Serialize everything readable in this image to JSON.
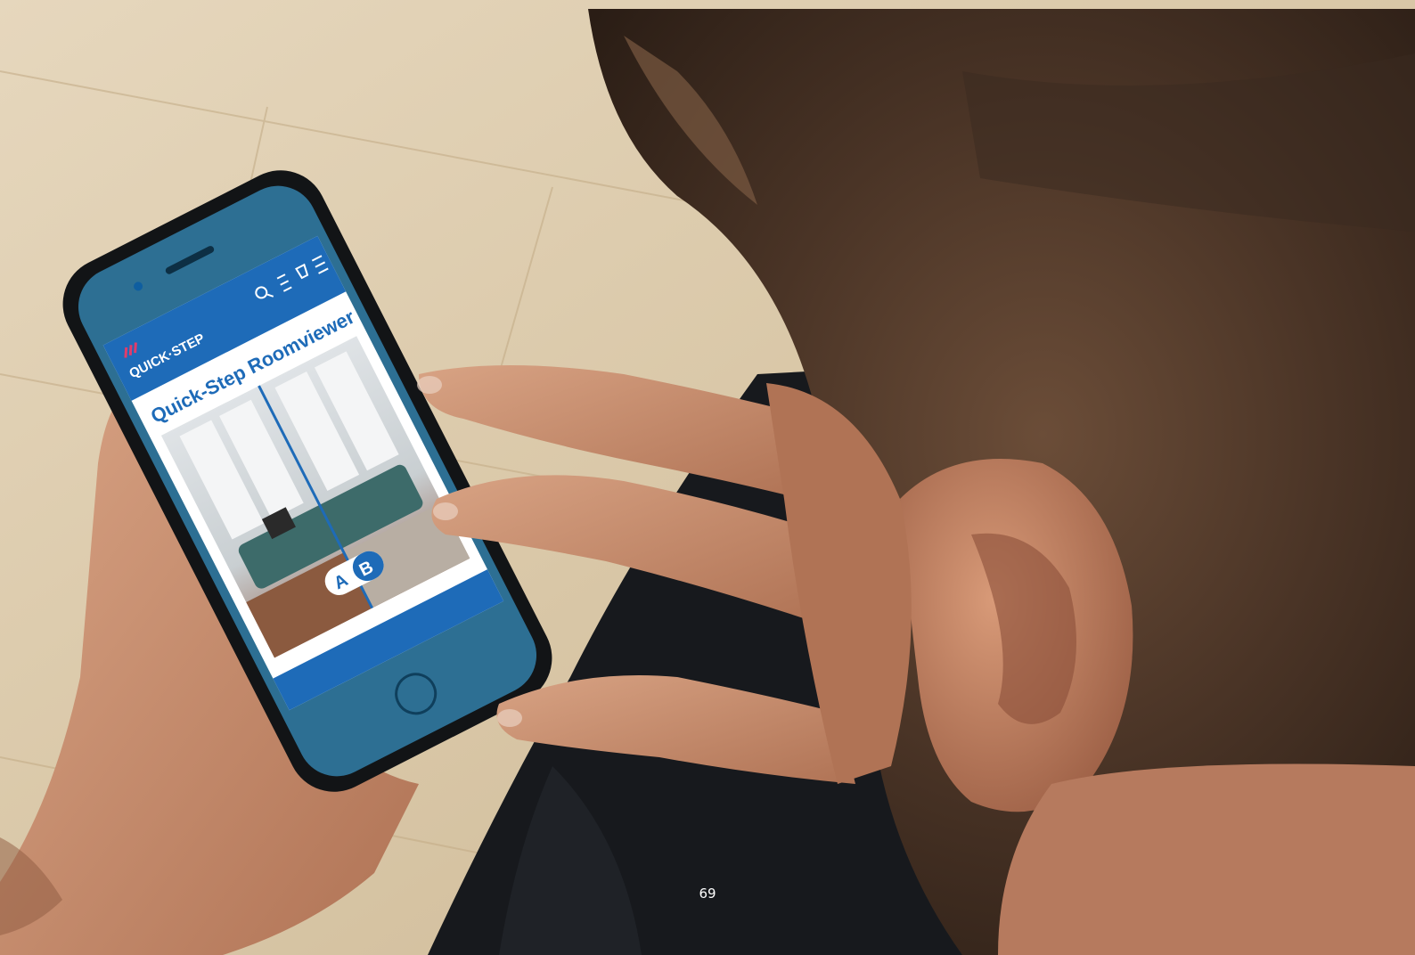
{
  "photo": {
    "subject": "person-holding-smartphone",
    "app": {
      "brand": "QUICK·STEP",
      "title": "Quick-Step Roomviewer",
      "compare_labels": [
        "A",
        "B"
      ],
      "icons": [
        "search-icon",
        "filter-icon",
        "cart-icon",
        "menu-icon"
      ]
    }
  },
  "page": {
    "number": "69"
  },
  "colors": {
    "brand_blue": "#1e6bb8",
    "floor": "#d8c7a8",
    "hair": "#4a3426",
    "skin": "#c98b6c",
    "shirt": "#17191d"
  }
}
